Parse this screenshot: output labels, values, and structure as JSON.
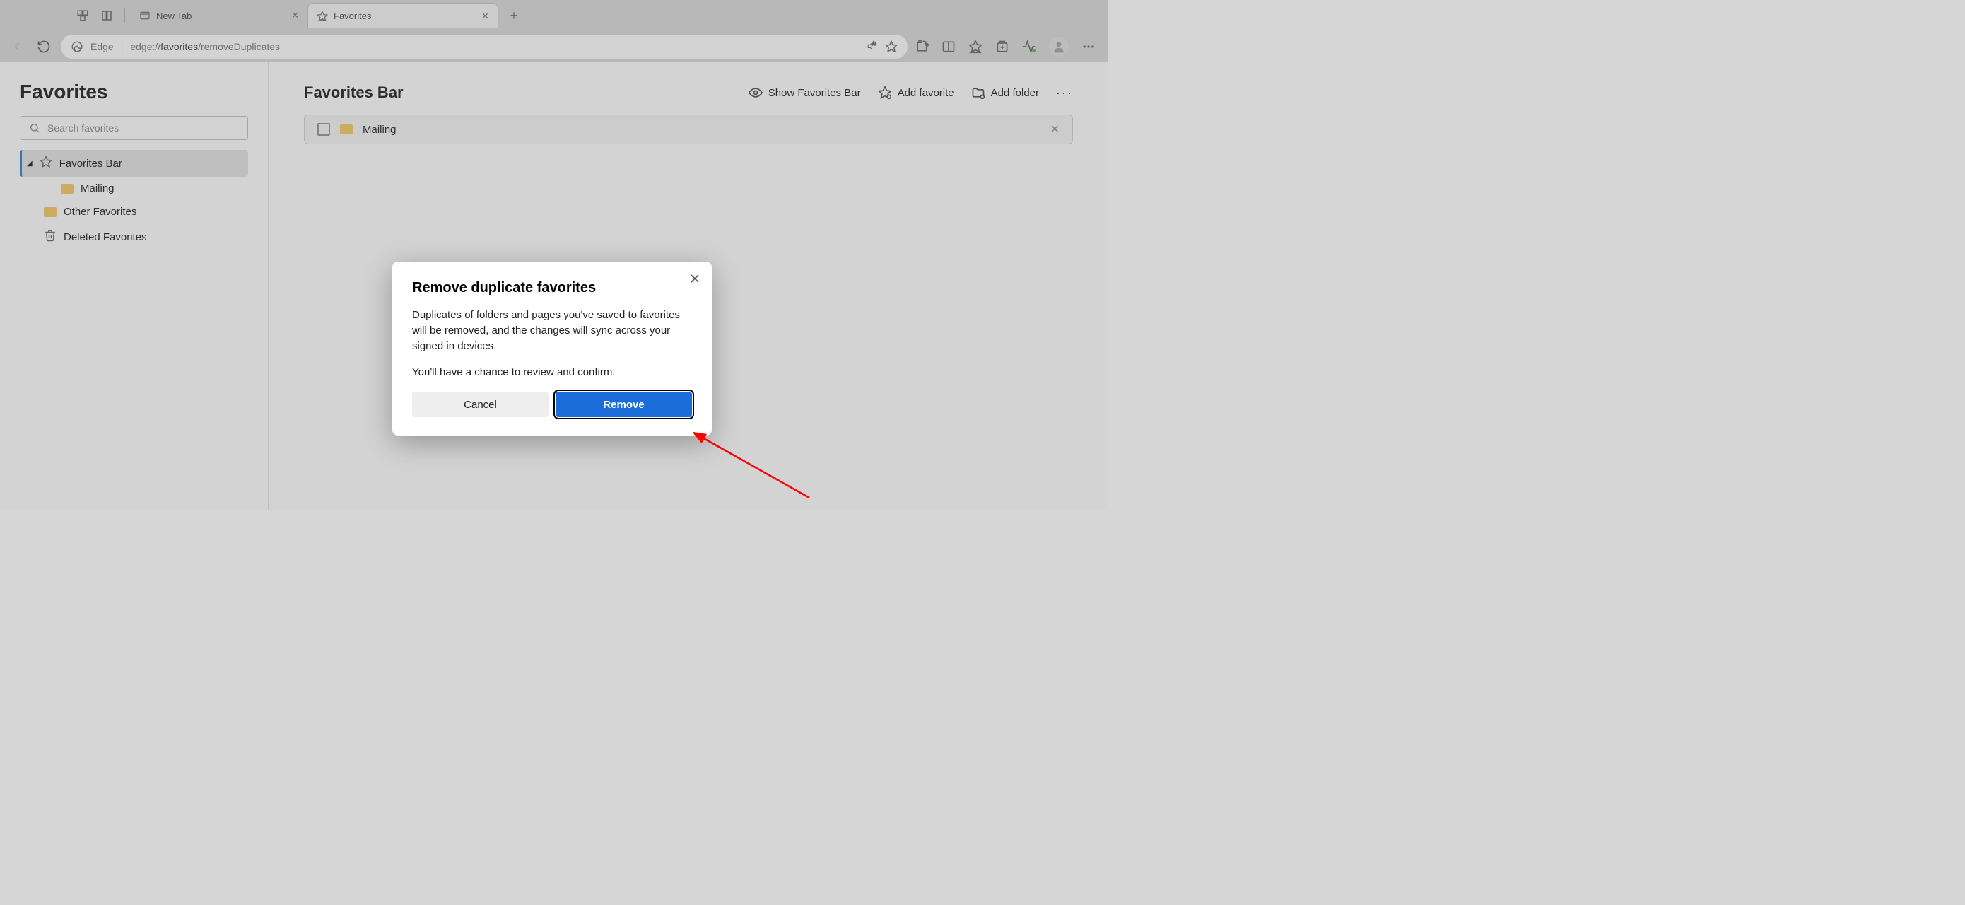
{
  "tabs": {
    "inactive": {
      "label": "New Tab"
    },
    "active": {
      "label": "Favorites"
    }
  },
  "address": {
    "edge_label": "Edge",
    "url_prefix": "edge://",
    "url_bold": "favorites",
    "url_suffix": "/removeDuplicates"
  },
  "sidebar": {
    "title": "Favorites",
    "search_placeholder": "Search favorites",
    "items": {
      "favorites_bar": "Favorites Bar",
      "mailing": "Mailing",
      "other": "Other Favorites",
      "deleted": "Deleted Favorites"
    }
  },
  "main": {
    "title": "Favorites Bar",
    "actions": {
      "show_bar": "Show Favorites Bar",
      "add_fav": "Add favorite",
      "add_folder": "Add folder"
    },
    "row": {
      "label": "Mailing"
    }
  },
  "modal": {
    "title": "Remove duplicate favorites",
    "body1": "Duplicates of folders and pages you've saved to favorites will be removed, and the changes will sync across your signed in devices.",
    "body2": "You'll have a chance to review and confirm.",
    "cancel": "Cancel",
    "remove": "Remove"
  }
}
